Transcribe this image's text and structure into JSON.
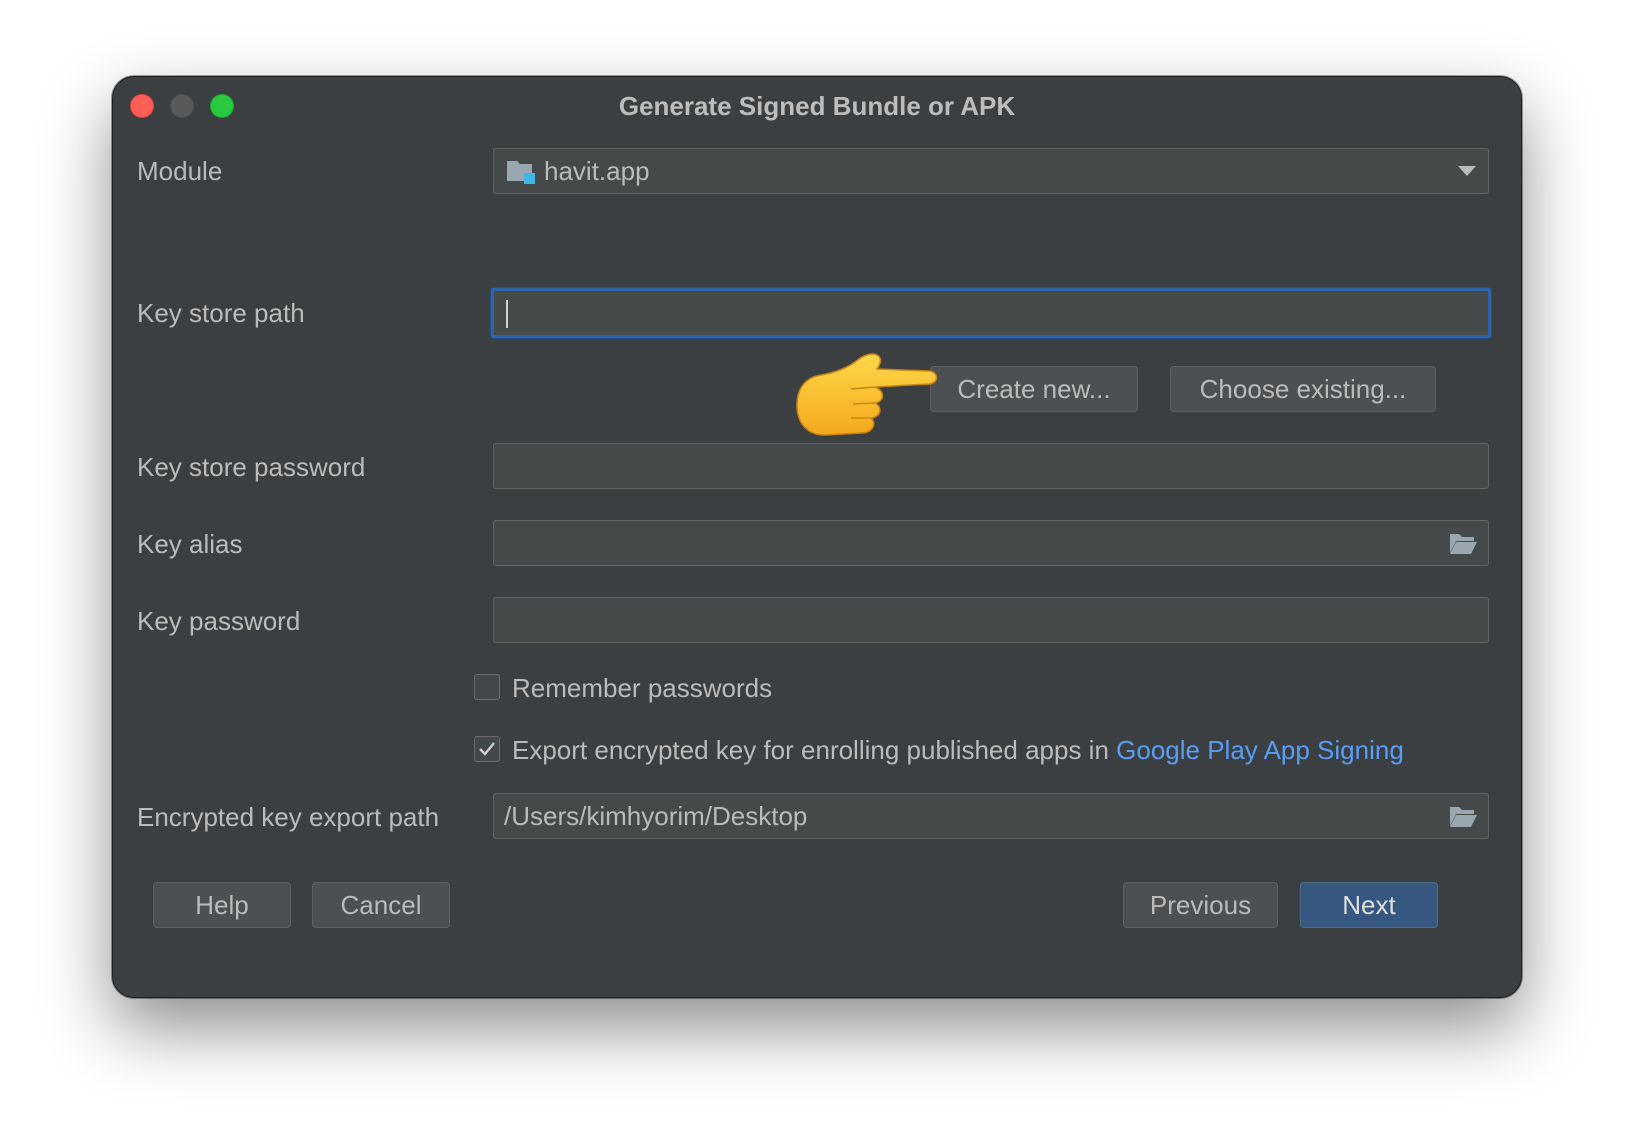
{
  "window": {
    "title": "Generate Signed Bundle or APK"
  },
  "form": {
    "module_label": "Module",
    "module_value": "havit.app",
    "keystore_path_label": "Key store path",
    "keystore_path_value": "",
    "create_new_label": "Create new...",
    "choose_existing_label": "Choose existing...",
    "keystore_password_label": "Key store password",
    "key_alias_label": "Key alias",
    "key_password_label": "Key password",
    "remember_passwords_label": "Remember passwords",
    "remember_passwords_checked": false,
    "export_key_label": "Export encrypted key for enrolling published apps in ",
    "export_key_link": "Google Play App Signing",
    "export_key_checked": true,
    "export_path_label": "Encrypted key export path",
    "export_path_value": "/Users/kimhyorim/Desktop"
  },
  "footer": {
    "help_label": "Help",
    "cancel_label": "Cancel",
    "previous_label": "Previous",
    "next_label": "Next"
  },
  "colors": {
    "window_bg": "#3c3f41",
    "accent": "#365880",
    "link": "#589df6",
    "focus_border": "#2f65a8"
  },
  "icons": {
    "module": "module-folder-icon",
    "folder": "folder-open-icon",
    "pointer": "pointing-hand-emoji-icon"
  }
}
